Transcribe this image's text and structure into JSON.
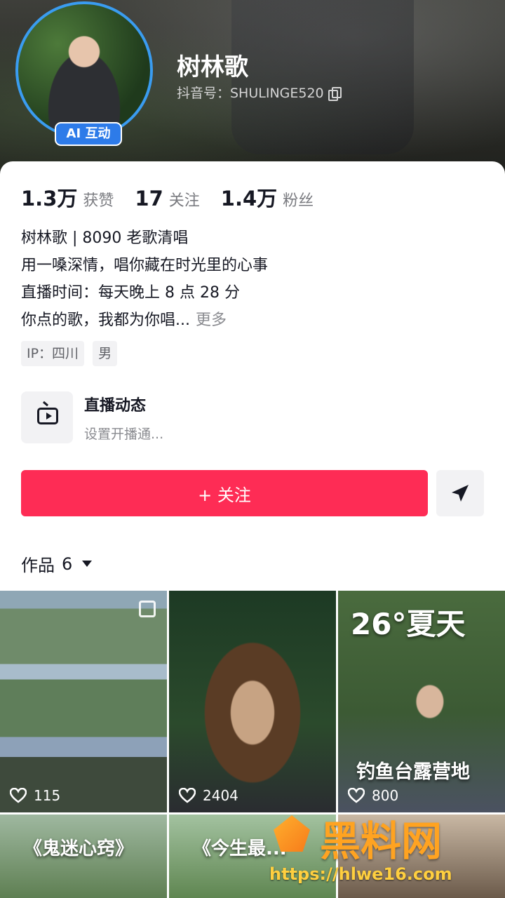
{
  "profile": {
    "name": "树林歌",
    "douyin_id": "抖音号：SHULINGE520",
    "ai_badge": "AI 互动"
  },
  "stats": [
    {
      "num": "1.3万",
      "label": "获赞"
    },
    {
      "num": "17",
      "label": "关注"
    },
    {
      "num": "1.4万",
      "label": "粉丝"
    }
  ],
  "bio": {
    "line1": "树林歌 | 8090 老歌清唱",
    "line2": "用一嗓深情，唱你藏在时光里的心事",
    "line3": "直播时间：每天晚上 8 点 28 分",
    "line4": "你点的歌，我都为你唱...",
    "more": "更多"
  },
  "tags": [
    "IP：四川",
    "男"
  ],
  "live": {
    "title": "直播动态",
    "subtitle": "设置开播通..."
  },
  "actions": {
    "follow_label": "+ 关注"
  },
  "works": {
    "label": "作品",
    "count": "6"
  },
  "tiles": [
    {
      "likes": "115"
    },
    {
      "likes": "2404"
    },
    {
      "likes": "800",
      "overlay_top": "26°夏天",
      "overlay_bottom": "钓鱼台露营地"
    },
    {
      "overlay": "《鬼迷心窍》"
    },
    {
      "overlay": "《今生最..."
    },
    {}
  ],
  "watermark": {
    "text": "黑料网",
    "url": "https://hlwe16.com"
  },
  "colors": {
    "accent": "#fe2c55",
    "ai_badge": "#2d7be9",
    "avatar_ring": "#3a9cf0"
  }
}
